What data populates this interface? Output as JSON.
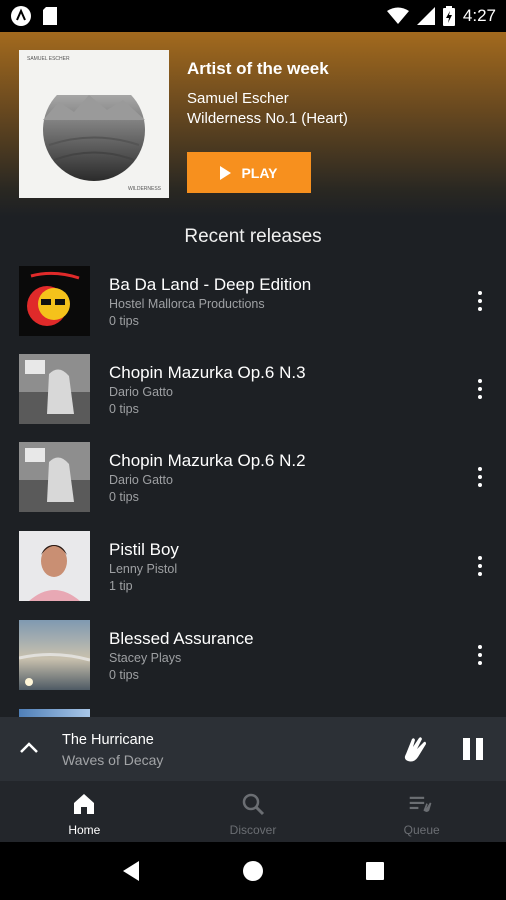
{
  "status_bar": {
    "time": "4:27",
    "left_icons": [
      "app-icon",
      "sd-card-icon"
    ],
    "right_icons": [
      "wifi-icon",
      "signal-icon",
      "battery-icon"
    ]
  },
  "hero": {
    "album_small_text_top": "SAMUEL ESCHER",
    "album_small_text_bottom": "WILDERNESS",
    "title": "Artist of the week",
    "artist": "Samuel Escher",
    "track": "Wilderness No.1 (Heart)",
    "play_label": "PLAY",
    "accent_color": "#f7901e"
  },
  "recent": {
    "heading": "Recent releases",
    "items": [
      {
        "title": "Ba Da Land - Deep Edition",
        "artist": "Hostel Mallorca Productions",
        "tips": "0 tips"
      },
      {
        "title": "Chopin Mazurka Op.6 N.3",
        "artist": "Dario Gatto",
        "tips": "0 tips"
      },
      {
        "title": "Chopin Mazurka Op.6 N.2",
        "artist": "Dario Gatto",
        "tips": "0 tips"
      },
      {
        "title": "Pistil Boy",
        "artist": "Lenny Pistol",
        "tips": "1 tip"
      },
      {
        "title": "Blessed Assurance",
        "artist": "Stacey Plays",
        "tips": "0 tips"
      }
    ]
  },
  "now_playing": {
    "title": "The Hurricane",
    "artist": "Waves of Decay"
  },
  "bottom_nav": {
    "items": [
      {
        "label": "Home",
        "icon": "home-icon",
        "active": true
      },
      {
        "label": "Discover",
        "icon": "search-icon",
        "active": false
      },
      {
        "label": "Queue",
        "icon": "queue-icon",
        "active": false
      }
    ]
  }
}
